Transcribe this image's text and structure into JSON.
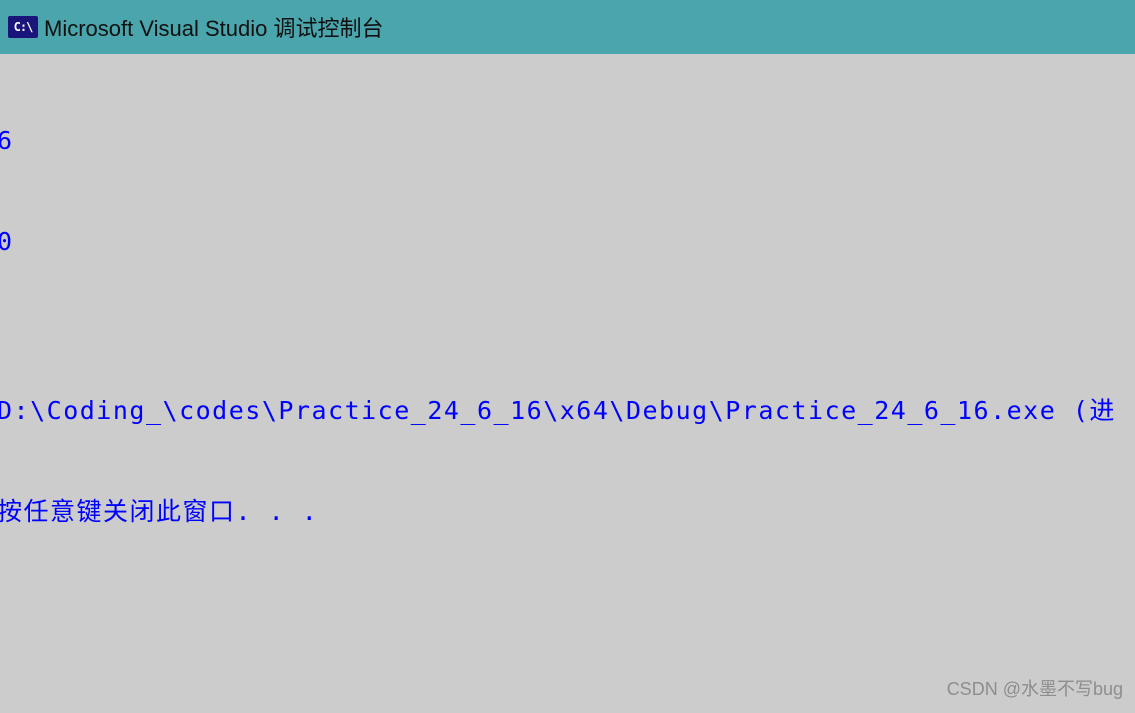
{
  "titleBar": {
    "iconText": "C:\\",
    "title": "Microsoft Visual Studio 调试控制台"
  },
  "console": {
    "lines": [
      "6",
      "0",
      "",
      "D:\\Coding_\\codes\\Practice_24_6_16\\x64\\Debug\\Practice_24_6_16.exe (进",
      "按任意键关闭此窗口. . ."
    ]
  },
  "watermark": "CSDN @水墨不写bug"
}
